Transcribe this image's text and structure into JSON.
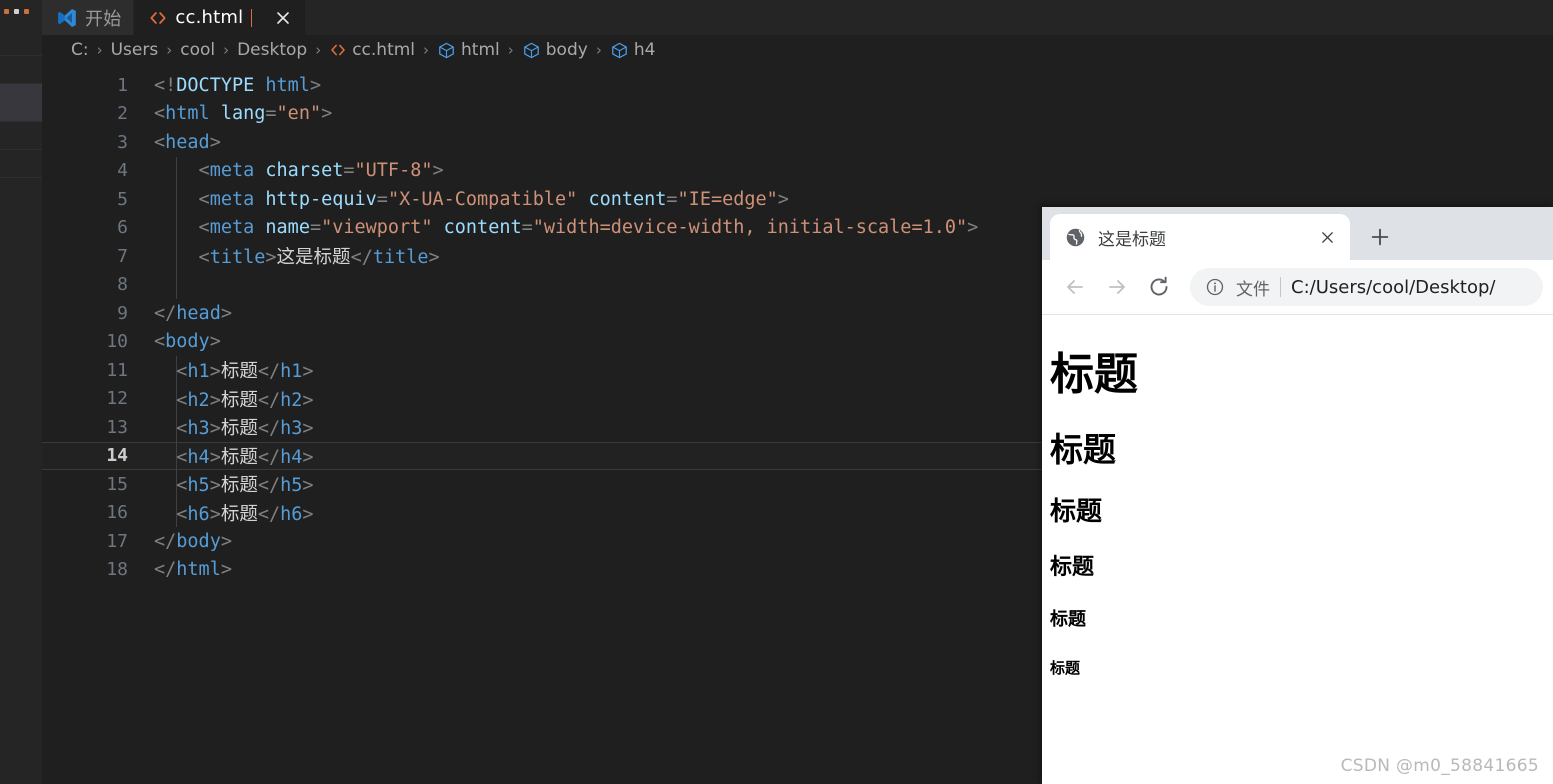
{
  "editor": {
    "tabs": [
      {
        "label": "开始",
        "icon": "vscode-logo-icon",
        "active": false,
        "closable": false
      },
      {
        "label": "cc.html",
        "icon": "html-file-icon",
        "active": true,
        "closable": true
      }
    ],
    "breadcrumb": [
      {
        "label": "C:",
        "icon": null
      },
      {
        "label": "Users",
        "icon": null
      },
      {
        "label": "cool",
        "icon": null
      },
      {
        "label": "Desktop",
        "icon": null
      },
      {
        "label": "cc.html",
        "icon": "html-file-icon"
      },
      {
        "label": "html",
        "icon": "symbol-field-icon"
      },
      {
        "label": "body",
        "icon": "symbol-field-icon"
      },
      {
        "label": "h4",
        "icon": "symbol-field-icon"
      }
    ],
    "breadcrumb_separator": "›",
    "current_line": 14,
    "lines": [
      {
        "n": "1",
        "indent": 0,
        "tokens": [
          {
            "t": "punct",
            "v": "<!"
          },
          {
            "t": "dt-word",
            "v": "DOCTYPE"
          },
          {
            "t": "txt",
            "v": " "
          },
          {
            "t": "tag",
            "v": "html"
          },
          {
            "t": "punct",
            "v": ">"
          }
        ]
      },
      {
        "n": "2",
        "indent": 0,
        "tokens": [
          {
            "t": "punct",
            "v": "<"
          },
          {
            "t": "tag",
            "v": "html"
          },
          {
            "t": "txt",
            "v": " "
          },
          {
            "t": "attr",
            "v": "lang"
          },
          {
            "t": "punct",
            "v": "="
          },
          {
            "t": "str",
            "v": "\"en\""
          },
          {
            "t": "punct",
            "v": ">"
          }
        ]
      },
      {
        "n": "3",
        "indent": 0,
        "tokens": [
          {
            "t": "punct",
            "v": "<"
          },
          {
            "t": "tag",
            "v": "head"
          },
          {
            "t": "punct",
            "v": ">"
          }
        ]
      },
      {
        "n": "4",
        "indent": 1,
        "tokens": [
          {
            "t": "punct",
            "v": "    <"
          },
          {
            "t": "tag",
            "v": "meta"
          },
          {
            "t": "txt",
            "v": " "
          },
          {
            "t": "attr",
            "v": "charset"
          },
          {
            "t": "punct",
            "v": "="
          },
          {
            "t": "str",
            "v": "\"UTF-8\""
          },
          {
            "t": "punct",
            "v": ">"
          }
        ]
      },
      {
        "n": "5",
        "indent": 1,
        "tokens": [
          {
            "t": "punct",
            "v": "    <"
          },
          {
            "t": "tag",
            "v": "meta"
          },
          {
            "t": "txt",
            "v": " "
          },
          {
            "t": "attr",
            "v": "http-equiv"
          },
          {
            "t": "punct",
            "v": "="
          },
          {
            "t": "str",
            "v": "\"X-UA-Compatible\""
          },
          {
            "t": "txt",
            "v": " "
          },
          {
            "t": "attr",
            "v": "content"
          },
          {
            "t": "punct",
            "v": "="
          },
          {
            "t": "str",
            "v": "\"IE=edge\""
          },
          {
            "t": "punct",
            "v": ">"
          }
        ]
      },
      {
        "n": "6",
        "indent": 1,
        "tokens": [
          {
            "t": "punct",
            "v": "    <"
          },
          {
            "t": "tag",
            "v": "meta"
          },
          {
            "t": "txt",
            "v": " "
          },
          {
            "t": "attr",
            "v": "name"
          },
          {
            "t": "punct",
            "v": "="
          },
          {
            "t": "str",
            "v": "\"viewport\""
          },
          {
            "t": "txt",
            "v": " "
          },
          {
            "t": "attr",
            "v": "content"
          },
          {
            "t": "punct",
            "v": "="
          },
          {
            "t": "str",
            "v": "\"width=device-width, initial-scale=1.0\""
          },
          {
            "t": "punct",
            "v": ">"
          }
        ]
      },
      {
        "n": "7",
        "indent": 1,
        "tokens": [
          {
            "t": "punct",
            "v": "    <"
          },
          {
            "t": "tag",
            "v": "title"
          },
          {
            "t": "punct",
            "v": ">"
          },
          {
            "t": "txt",
            "v": "这是标题"
          },
          {
            "t": "punct",
            "v": "</"
          },
          {
            "t": "tag",
            "v": "title"
          },
          {
            "t": "punct",
            "v": ">"
          }
        ]
      },
      {
        "n": "8",
        "indent": 1,
        "tokens": []
      },
      {
        "n": "9",
        "indent": 0,
        "tokens": [
          {
            "t": "punct",
            "v": "</"
          },
          {
            "t": "tag",
            "v": "head"
          },
          {
            "t": "punct",
            "v": ">"
          }
        ]
      },
      {
        "n": "10",
        "indent": 0,
        "tokens": [
          {
            "t": "punct",
            "v": "<"
          },
          {
            "t": "tag",
            "v": "body"
          },
          {
            "t": "punct",
            "v": ">"
          }
        ]
      },
      {
        "n": "11",
        "indent": 1,
        "tokens": [
          {
            "t": "punct",
            "v": "  <"
          },
          {
            "t": "tag",
            "v": "h1"
          },
          {
            "t": "punct",
            "v": ">"
          },
          {
            "t": "txt",
            "v": "标题"
          },
          {
            "t": "punct",
            "v": "</"
          },
          {
            "t": "tag",
            "v": "h1"
          },
          {
            "t": "punct",
            "v": ">"
          }
        ]
      },
      {
        "n": "12",
        "indent": 1,
        "tokens": [
          {
            "t": "punct",
            "v": "  <"
          },
          {
            "t": "tag",
            "v": "h2"
          },
          {
            "t": "punct",
            "v": ">"
          },
          {
            "t": "txt",
            "v": "标题"
          },
          {
            "t": "punct",
            "v": "</"
          },
          {
            "t": "tag",
            "v": "h2"
          },
          {
            "t": "punct",
            "v": ">"
          }
        ]
      },
      {
        "n": "13",
        "indent": 1,
        "tokens": [
          {
            "t": "punct",
            "v": "  <"
          },
          {
            "t": "tag",
            "v": "h3"
          },
          {
            "t": "punct",
            "v": ">"
          },
          {
            "t": "txt",
            "v": "标题"
          },
          {
            "t": "punct",
            "v": "</"
          },
          {
            "t": "tag",
            "v": "h3"
          },
          {
            "t": "punct",
            "v": ">"
          }
        ]
      },
      {
        "n": "14",
        "indent": 1,
        "tokens": [
          {
            "t": "punct",
            "v": "  <"
          },
          {
            "t": "tag",
            "v": "h4"
          },
          {
            "t": "punct",
            "v": ">"
          },
          {
            "t": "txt",
            "v": "标题"
          },
          {
            "t": "punct",
            "v": "</"
          },
          {
            "t": "tag",
            "v": "h4"
          },
          {
            "t": "punct",
            "v": ">"
          }
        ]
      },
      {
        "n": "15",
        "indent": 1,
        "tokens": [
          {
            "t": "punct",
            "v": "  <"
          },
          {
            "t": "tag",
            "v": "h5"
          },
          {
            "t": "punct",
            "v": ">"
          },
          {
            "t": "txt",
            "v": "标题"
          },
          {
            "t": "punct",
            "v": "</"
          },
          {
            "t": "tag",
            "v": "h5"
          },
          {
            "t": "punct",
            "v": ">"
          }
        ]
      },
      {
        "n": "16",
        "indent": 1,
        "tokens": [
          {
            "t": "punct",
            "v": "  <"
          },
          {
            "t": "tag",
            "v": "h6"
          },
          {
            "t": "punct",
            "v": ">"
          },
          {
            "t": "txt",
            "v": "标题"
          },
          {
            "t": "punct",
            "v": "</"
          },
          {
            "t": "tag",
            "v": "h6"
          },
          {
            "t": "punct",
            "v": ">"
          }
        ]
      },
      {
        "n": "17",
        "indent": 0,
        "tokens": [
          {
            "t": "punct",
            "v": "</"
          },
          {
            "t": "tag",
            "v": "body"
          },
          {
            "t": "punct",
            "v": ">"
          }
        ]
      },
      {
        "n": "18",
        "indent": 0,
        "tokens": [
          {
            "t": "punct",
            "v": "</"
          },
          {
            "t": "tag",
            "v": "html"
          },
          {
            "t": "punct",
            "v": ">"
          }
        ]
      }
    ]
  },
  "browser": {
    "tab": {
      "title": "这是标题",
      "favicon": "globe-icon",
      "close_label": "✕"
    },
    "new_tab_label": "+",
    "toolbar": {
      "back_label": "←",
      "forward_label": "→",
      "reload_label": "⟳",
      "omnibox": {
        "info_icon": "info-circle-icon",
        "scheme_label": "文件",
        "url": "C:/Users/cool/Desktop/"
      }
    },
    "page": {
      "h1": "标题",
      "h2": "标题",
      "h3": "标题",
      "h4": "标题",
      "h5": "标题",
      "h6": "标题"
    }
  },
  "watermark": "CSDN @m0_58841665",
  "colors": {
    "editor_bg": "#1f1f1f",
    "tabbar_bg": "#252526",
    "tag": "#569cd6",
    "attr": "#9cdcfe",
    "string": "#ce9178",
    "punct": "#808080",
    "accent_orange": "#e06c3a",
    "browser_chrome": "#dee1e6"
  }
}
